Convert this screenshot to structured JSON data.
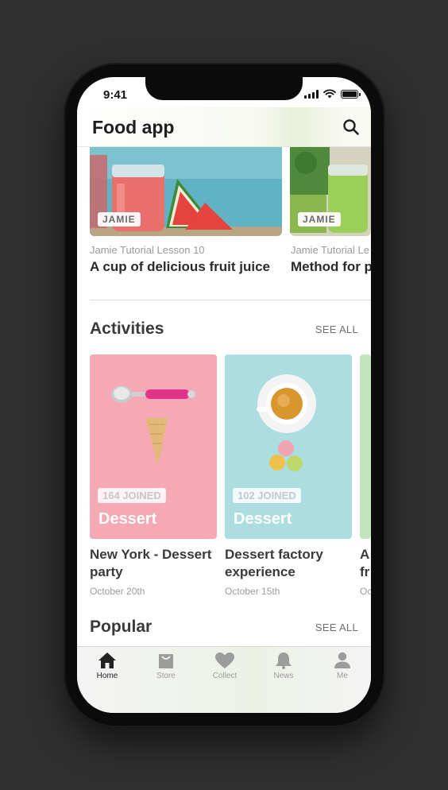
{
  "status_bar": {
    "time": "9:41"
  },
  "header": {
    "title": "Food app",
    "search_icon": "search-icon"
  },
  "tutorials": [
    {
      "tag": "JAMIE",
      "subtitle": "Jamie Tutorial Lesson 10",
      "title": "A cup of delicious fruit juice"
    },
    {
      "tag": "JAMIE",
      "subtitle": "Jamie Tutorial Le",
      "title": "Method for p"
    }
  ],
  "activities": {
    "title": "Activities",
    "see_all": "SEE ALL",
    "items": [
      {
        "joined": "164 JOINED",
        "category": "Dessert",
        "title": "New York - Dessert party",
        "date": "October 20th"
      },
      {
        "joined": "102 JOINED",
        "category": "Dessert",
        "title": "Dessert factory experience",
        "date": "October 15th"
      },
      {
        "title": "A fr",
        "date": "Oc"
      }
    ]
  },
  "popular": {
    "title": "Popular",
    "see_all": "SEE ALL"
  },
  "tab_bar": {
    "items": [
      {
        "label": "Home",
        "icon": "home-icon",
        "active": true
      },
      {
        "label": "Store",
        "icon": "bag-icon",
        "active": false
      },
      {
        "label": "Collect",
        "icon": "heart-icon",
        "active": false
      },
      {
        "label": "News",
        "icon": "bell-icon",
        "active": false
      },
      {
        "label": "Me",
        "icon": "person-icon",
        "active": false
      }
    ]
  },
  "colors": {
    "background": "#2f2f2f",
    "activity_card_1": "#f4a7b2",
    "activity_card_2": "#a9dde0",
    "tab_active": "#222222",
    "tab_inactive": "#9c9c9c"
  }
}
